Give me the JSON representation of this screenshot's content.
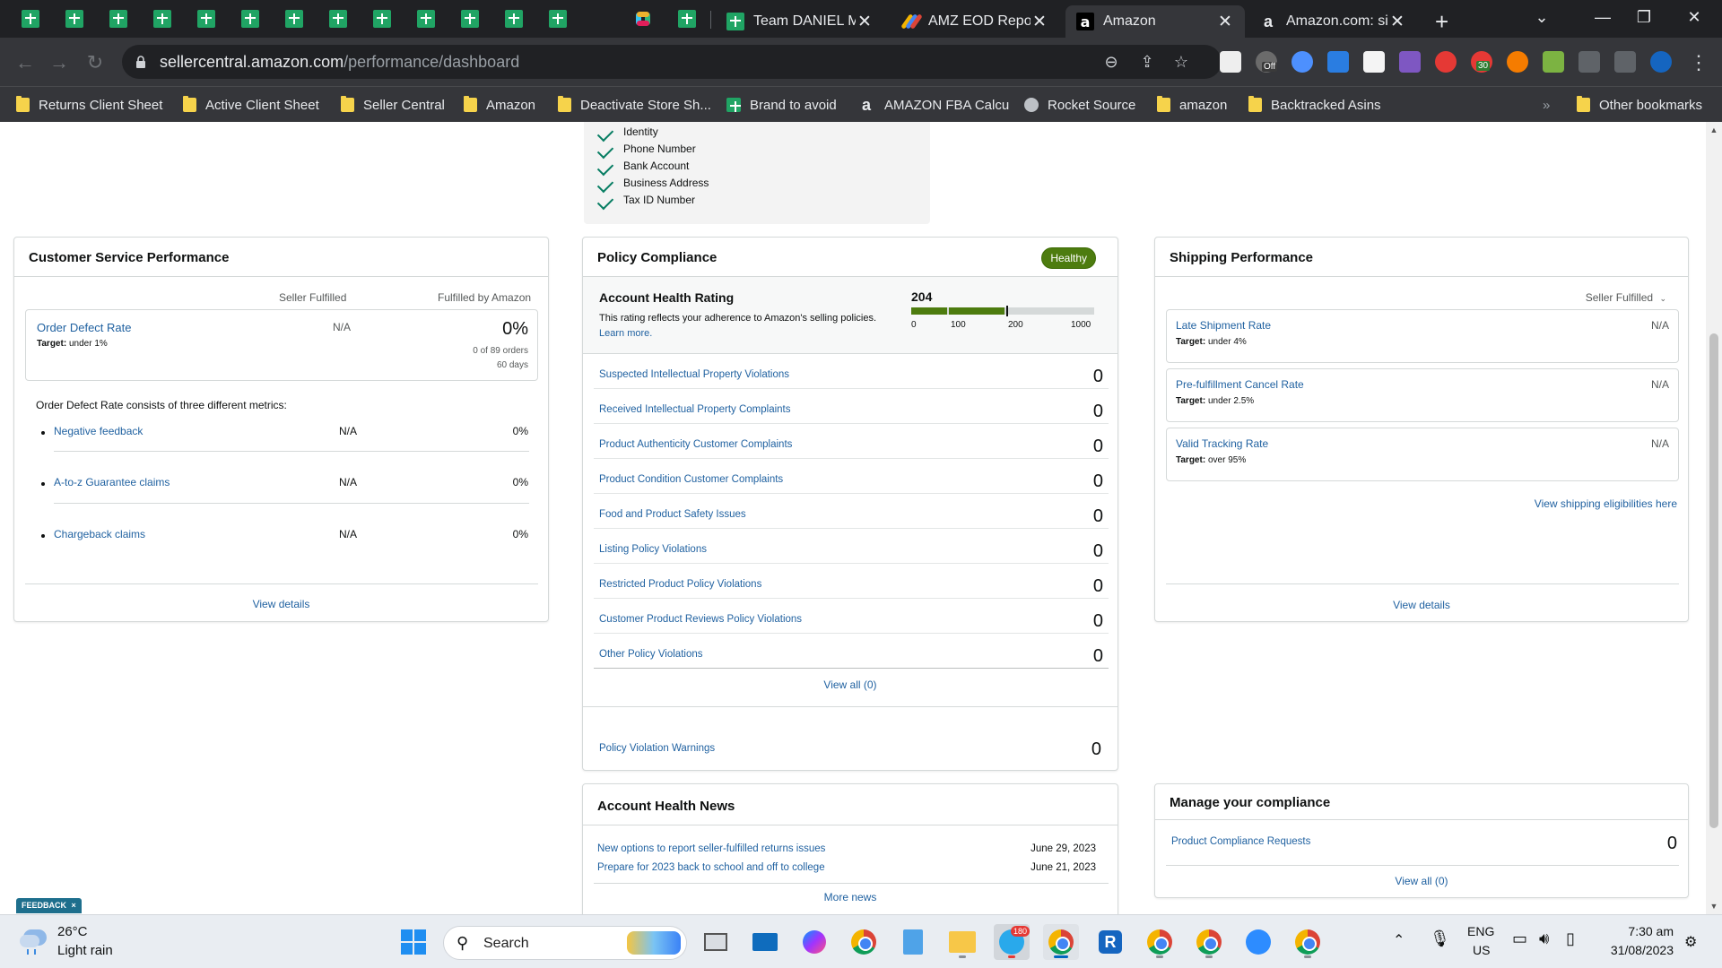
{
  "browser": {
    "tabs": [
      {
        "title": "Team DANIEL Mo",
        "icon": "google-sheets-icon"
      },
      {
        "title": "AMZ EOD Report",
        "icon": "eod-report-icon"
      },
      {
        "title": "Amazon",
        "icon": "amazon-icon",
        "active": true
      },
      {
        "title": "Amazon.com: sim",
        "icon": "amazon-icon"
      }
    ],
    "new_tab_label": "+",
    "url_host": "sellercentral.amazon.com",
    "url_path": "/performance/dashboard",
    "extension_badges": {
      "off": "Off",
      "count": "30"
    },
    "bookmarks": [
      "Returns Client Sheet",
      "Active Client Sheet",
      "Seller Central",
      "Amazon",
      "Deactivate Store Sh...",
      "Brand to avoid",
      "AMAZON FBA Calcu",
      "Rocket Source",
      "amazon",
      "Backtracked Asins"
    ],
    "bookmarks_overflow": "»",
    "other_bookmarks": "Other bookmarks"
  },
  "verification": {
    "items": [
      "Identity",
      "Phone Number",
      "Bank Account",
      "Business Address",
      "Tax ID Number"
    ]
  },
  "customer_service": {
    "title": "Customer Service Performance",
    "col_seller": "Seller Fulfilled",
    "col_fba": "Fulfilled by Amazon",
    "odr_label": "Order Defect Rate",
    "odr_target_prefix": "Target:",
    "odr_target": "under 1%",
    "odr_seller": "N/A",
    "odr_fba": "0%",
    "odr_orders": "0 of 89 orders",
    "odr_days": "60 days",
    "metrics_intro": "Order Defect Rate consists of three different metrics:",
    "metrics": [
      {
        "label": "Negative feedback",
        "seller": "N/A",
        "fba": "0%"
      },
      {
        "label": "A-to-z Guarantee claims",
        "seller": "N/A",
        "fba": "0%"
      },
      {
        "label": "Chargeback claims",
        "seller": "N/A",
        "fba": "0%"
      }
    ],
    "view_details": "View details"
  },
  "policy": {
    "title": "Policy Compliance",
    "status": "Healthy",
    "status_color": "#4d7c0f",
    "ahr_title": "Account Health Rating",
    "ahr_desc": "This rating reflects your adherence to Amazon's selling policies.",
    "ahr_learn_more": "Learn more.",
    "ahr_value": "204",
    "ahr_scale": [
      "0",
      "100",
      "200",
      "1000"
    ],
    "ahr_fill_fraction": 0.204,
    "items": [
      {
        "label": "Suspected Intellectual Property Violations",
        "count": "0"
      },
      {
        "label": "Received Intellectual Property Complaints",
        "count": "0"
      },
      {
        "label": "Product Authenticity Customer Complaints",
        "count": "0"
      },
      {
        "label": "Product Condition Customer Complaints",
        "count": "0"
      },
      {
        "label": "Food and Product Safety Issues",
        "count": "0"
      },
      {
        "label": "Listing Policy Violations",
        "count": "0"
      },
      {
        "label": "Restricted Product Policy Violations",
        "count": "0"
      },
      {
        "label": "Customer Product Reviews Policy Violations",
        "count": "0"
      },
      {
        "label": "Other Policy Violations",
        "count": "0"
      }
    ],
    "view_all": "View all (0)",
    "warnings_label": "Policy Violation Warnings",
    "warnings_count": "0"
  },
  "shipping": {
    "title": "Shipping Performance",
    "filter": "Seller Fulfilled",
    "items": [
      {
        "label": "Late Shipment Rate",
        "target": "under 4%",
        "value": "N/A"
      },
      {
        "label": "Pre-fulfillment Cancel Rate",
        "target": "under 2.5%",
        "value": "N/A"
      },
      {
        "label": "Valid Tracking Rate",
        "target": "over 95%",
        "value": "N/A"
      }
    ],
    "target_prefix": "Target:",
    "eligibilities": "View shipping eligibilities here",
    "view_details": "View details"
  },
  "news": {
    "title": "Account Health News",
    "items": [
      {
        "text": "New options to report seller-fulfilled returns issues",
        "date": "June 29, 2023"
      },
      {
        "text": "Prepare for 2023 back to school and off to college",
        "date": "June 21, 2023"
      }
    ],
    "more": "More news"
  },
  "compliance": {
    "title": "Manage your compliance",
    "requests_label": "Product Compliance Requests",
    "requests_count": "0",
    "view_all": "View all (0)"
  },
  "feedback": {
    "label": "FEEDBACK",
    "close": "×"
  },
  "taskbar": {
    "weather_temp": "26°C",
    "weather_desc": "Light rain",
    "search_label": "Search",
    "telegram_badge": "180",
    "lang": "ENG",
    "region": "US",
    "time": "7:30 am",
    "date": "31/08/2023"
  }
}
